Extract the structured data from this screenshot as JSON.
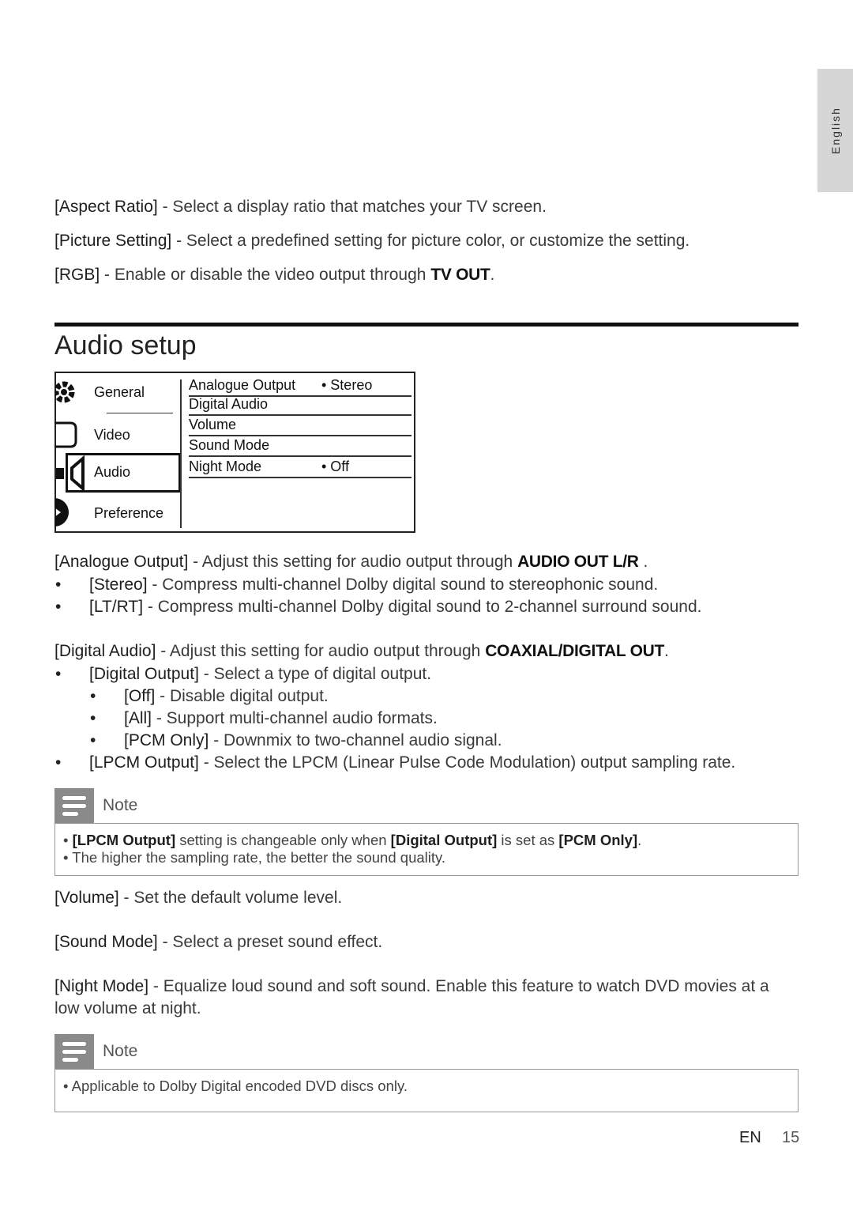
{
  "side_tab": {
    "label": "English"
  },
  "intro_lines": [
    {
      "term": "[Aspect Ratio]",
      "desc": " - Select a display ratio that matches your TV screen."
    },
    {
      "term": "[Picture Setting]",
      "desc": " - Select a predefined setting for picture color, or customize the setting."
    },
    {
      "term": "[RGB]",
      "desc": " - Enable or disable the video output through ",
      "emph": "TV OUT",
      "tail": "."
    }
  ],
  "section_title": "Audio setup",
  "menu": {
    "categories": [
      {
        "label": "General",
        "icon": "gear-icon"
      },
      {
        "label": "Video",
        "icon": "screen-icon"
      },
      {
        "label": "Audio",
        "icon": "speaker-icon",
        "selected": true
      },
      {
        "label": "Preference",
        "icon": "preference-icon"
      }
    ],
    "options": [
      {
        "label": "Analogue Output",
        "value": "• Stereo"
      },
      {
        "label": "Digital Audio",
        "value": ""
      },
      {
        "label": "Volume",
        "value": ""
      },
      {
        "label": "Sound Mode",
        "value": ""
      },
      {
        "label": "Night Mode",
        "value": "• Off"
      }
    ]
  },
  "body_lines": [
    {
      "level": 0,
      "term": "[Analogue Output]",
      "desc": " - Adjust this setting for audio output through ",
      "emph": "AUDIO OUT L/R",
      "tail": " ."
    },
    {
      "level": 1,
      "term": "[Stereo]",
      "desc": " - Compress multi-channel Dolby digital sound to stereophonic sound."
    },
    {
      "level": 1,
      "term": "[LT/RT]",
      "desc": " - Compress multi-channel Dolby digital sound to 2-channel surround sound."
    },
    {
      "level": 0,
      "term": "[Digital Audio]",
      "desc": " - Adjust this setting for audio output through ",
      "emph": "COAXIAL/DIGITAL OUT",
      "tail": "."
    },
    {
      "level": 1,
      "term": "[Digital Output]",
      "desc": " - Select a type of digital output."
    },
    {
      "level": 2,
      "term": "[Off]",
      "desc": " - Disable digital output."
    },
    {
      "level": 2,
      "term": "[All]",
      "desc": " - Support multi-channel audio formats."
    },
    {
      "level": 2,
      "term": "[PCM Only]",
      "desc": " - Downmix to two-channel audio signal."
    },
    {
      "level": 1,
      "term": "[LPCM Output]",
      "desc": " - Select the LPCM (Linear Pulse Code Modulation) output sampling rate."
    }
  ],
  "note1": {
    "label": "Note",
    "items": [
      {
        "parts": [
          {
            "b": "[LPCM Output]"
          },
          {
            "t": " setting is changeable only when "
          },
          {
            "b": "[Digital Output]"
          },
          {
            "t": " is set as "
          },
          {
            "b": "[PCM Only]"
          },
          {
            "t": "."
          }
        ]
      },
      {
        "parts": [
          {
            "t": "The higher the sampling rate, the better the sound quality."
          }
        ]
      }
    ]
  },
  "lower_lines": [
    {
      "term": "[Volume]",
      "desc": " - Set the default volume level."
    },
    {
      "term": "[Sound Mode]",
      "desc": " - Select a preset sound effect."
    },
    {
      "term": "[Night Mode]",
      "desc": " - Equalize loud sound and soft sound. Enable this feature to watch DVD movies at a"
    },
    {
      "term": "",
      "desc": "low volume at night."
    }
  ],
  "note2": {
    "label": "Note",
    "items": [
      {
        "parts": [
          {
            "t": "Applicable to Dolby Digital encoded DVD discs only."
          }
        ]
      }
    ]
  },
  "footer": {
    "lang": "EN",
    "page": "15"
  }
}
